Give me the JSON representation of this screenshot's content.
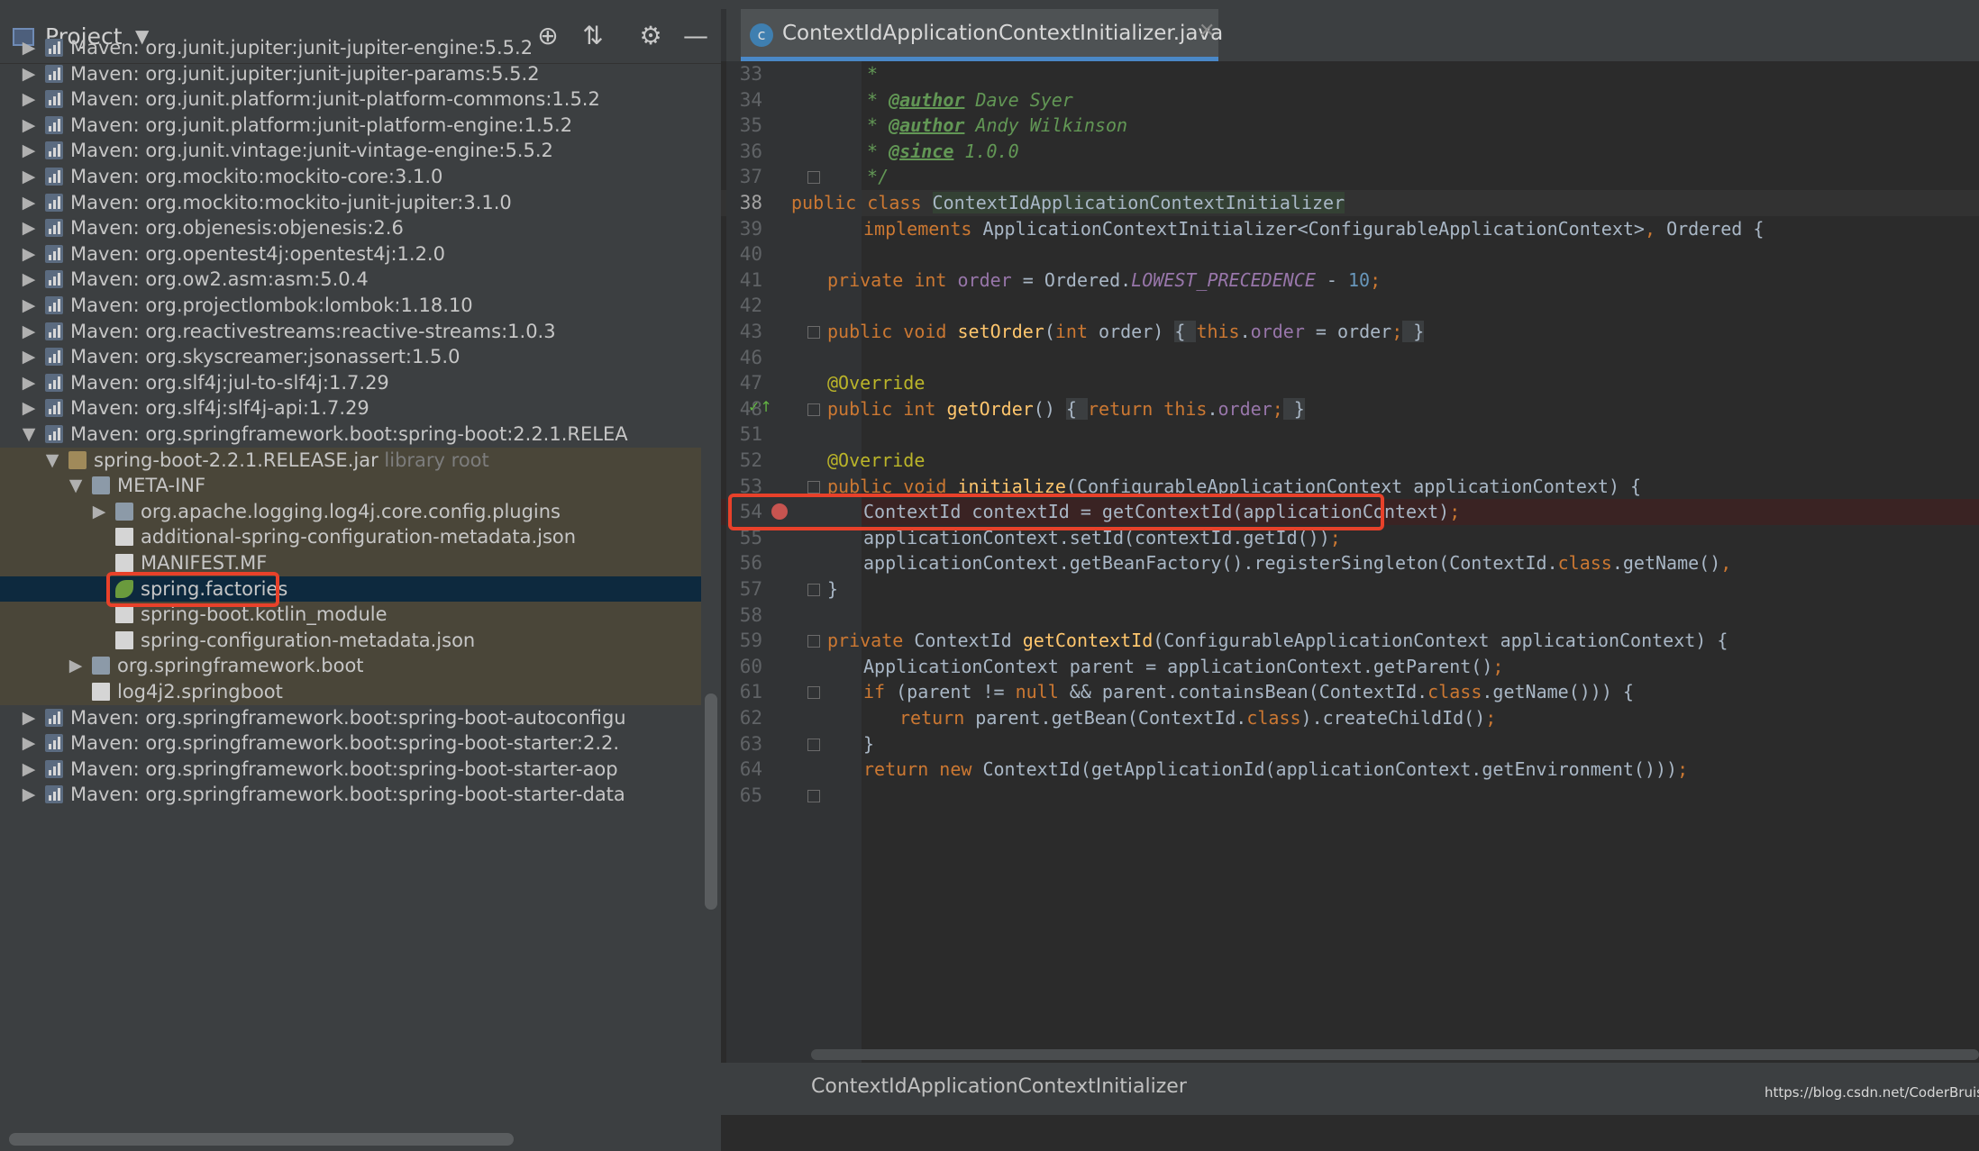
{
  "project_panel": {
    "title": "Project",
    "tree": [
      {
        "label": "Maven: org.junit.jupiter:junit-jupiter-engine:5.5.2",
        "kind": "maven",
        "arrow": "right",
        "depth": 0
      },
      {
        "label": "Maven: org.junit.jupiter:junit-jupiter-params:5.5.2",
        "kind": "maven",
        "arrow": "right",
        "depth": 0
      },
      {
        "label": "Maven: org.junit.platform:junit-platform-commons:1.5.2",
        "kind": "maven",
        "arrow": "right",
        "depth": 0
      },
      {
        "label": "Maven: org.junit.platform:junit-platform-engine:1.5.2",
        "kind": "maven",
        "arrow": "right",
        "depth": 0
      },
      {
        "label": "Maven: org.junit.vintage:junit-vintage-engine:5.5.2",
        "kind": "maven",
        "arrow": "right",
        "depth": 0
      },
      {
        "label": "Maven: org.mockito:mockito-core:3.1.0",
        "kind": "maven",
        "arrow": "right",
        "depth": 0
      },
      {
        "label": "Maven: org.mockito:mockito-junit-jupiter:3.1.0",
        "kind": "maven",
        "arrow": "right",
        "depth": 0
      },
      {
        "label": "Maven: org.objenesis:objenesis:2.6",
        "kind": "maven",
        "arrow": "right",
        "depth": 0
      },
      {
        "label": "Maven: org.opentest4j:opentest4j:1.2.0",
        "kind": "maven",
        "arrow": "right",
        "depth": 0
      },
      {
        "label": "Maven: org.ow2.asm:asm:5.0.4",
        "kind": "maven",
        "arrow": "right",
        "depth": 0
      },
      {
        "label": "Maven: org.projectlombok:lombok:1.18.10",
        "kind": "maven",
        "arrow": "right",
        "depth": 0
      },
      {
        "label": "Maven: org.reactivestreams:reactive-streams:1.0.3",
        "kind": "maven",
        "arrow": "right",
        "depth": 0
      },
      {
        "label": "Maven: org.skyscreamer:jsonassert:1.5.0",
        "kind": "maven",
        "arrow": "right",
        "depth": 0
      },
      {
        "label": "Maven: org.slf4j:jul-to-slf4j:1.7.29",
        "kind": "maven",
        "arrow": "right",
        "depth": 0
      },
      {
        "label": "Maven: org.slf4j:slf4j-api:1.7.29",
        "kind": "maven",
        "arrow": "right",
        "depth": 0
      },
      {
        "label": "Maven: org.springframework.boot:spring-boot:2.2.1.RELEA",
        "kind": "maven",
        "arrow": "down",
        "depth": 0
      },
      {
        "label": "spring-boot-2.2.1.RELEASE.jar",
        "suffix": "library root",
        "kind": "jar",
        "arrow": "down",
        "depth": 1
      },
      {
        "label": "META-INF",
        "kind": "folder",
        "arrow": "down",
        "depth": 2
      },
      {
        "label": "org.apache.logging.log4j.core.config.plugins",
        "kind": "folder",
        "arrow": "right",
        "depth": 3
      },
      {
        "label": "additional-spring-configuration-metadata.json",
        "kind": "file",
        "arrow": "",
        "depth": 3
      },
      {
        "label": "MANIFEST.MF",
        "kind": "file",
        "arrow": "",
        "depth": 3
      },
      {
        "label": "spring.factories",
        "kind": "spring",
        "arrow": "",
        "depth": 3
      },
      {
        "label": "spring-boot.kotlin_module",
        "kind": "file",
        "arrow": "",
        "depth": 3
      },
      {
        "label": "spring-configuration-metadata.json",
        "kind": "file",
        "arrow": "",
        "depth": 3
      },
      {
        "label": "org.springframework.boot",
        "kind": "folder",
        "arrow": "right",
        "depth": 2
      },
      {
        "label": "log4j2.springboot",
        "kind": "file",
        "arrow": "",
        "depth": 2
      },
      {
        "label": "Maven: org.springframework.boot:spring-boot-autoconfigu",
        "kind": "maven",
        "arrow": "right",
        "depth": 0
      },
      {
        "label": "Maven: org.springframework.boot:spring-boot-starter:2.2.",
        "kind": "maven",
        "arrow": "right",
        "depth": 0
      },
      {
        "label": "Maven: org.springframework.boot:spring-boot-starter-aop",
        "kind": "maven",
        "arrow": "right",
        "depth": 0
      },
      {
        "label": "Maven: org.springframework.boot:spring-boot-starter-data",
        "kind": "maven",
        "arrow": "right",
        "depth": 0
      }
    ],
    "toolbar_icons": [
      "locate-icon",
      "collapse-all-icon",
      "gear-icon",
      "hide-icon"
    ]
  },
  "editor": {
    "tab_label": "ContextIdApplicationContextInitializer.java",
    "line_numbers": [
      "33",
      "34",
      "35",
      "36",
      "37",
      "38",
      "39",
      "40",
      "41",
      "42",
      "43",
      "46",
      "47",
      "48",
      "51",
      "52",
      "53",
      "54",
      "55",
      "56",
      "57",
      "58",
      "59",
      "60",
      "61",
      "62",
      "63",
      "64",
      "65"
    ],
    "current_line": "38",
    "breakpoint_line": "54",
    "breadcrumb": "ContextIdApplicationContextInitializer",
    "watermark": "https://blog.csdn.net/CoderBruis"
  },
  "colors": {
    "highlight_box": "#e8412a",
    "selection": "#0d293e",
    "library_bg": "#4a4639",
    "breakpoint": "#c75450"
  }
}
